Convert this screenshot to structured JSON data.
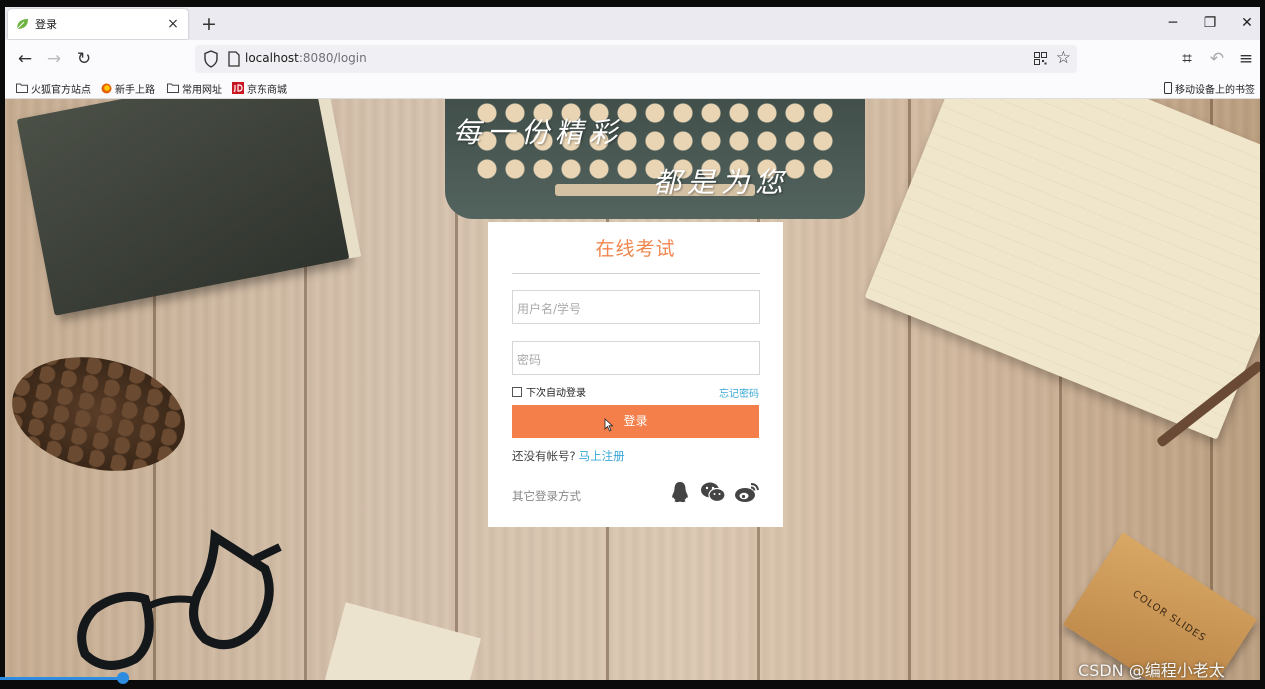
{
  "tab": {
    "title": "登录",
    "close": "×",
    "new_tab": "+"
  },
  "window": {
    "minimize": "─",
    "restore": "❐",
    "close": "✕"
  },
  "nav": {
    "back": "←",
    "forward": "→",
    "reload": "↻"
  },
  "address": {
    "host": "localhost",
    "path": ":8080/login",
    "star": "☆"
  },
  "toolbar": {
    "crop": "⌗",
    "undo": "↶",
    "menu": "≡"
  },
  "bookmarks": [
    {
      "label": "火狐官方站点"
    },
    {
      "label": "新手上路"
    },
    {
      "label": "常用网址"
    },
    {
      "label": "京东商城"
    }
  ],
  "mobile_bookmarks": "移动设备上的书签",
  "banner": {
    "line1": "每一份精彩",
    "line2": "都是为您"
  },
  "box_label": "COLOR SLIDES",
  "login": {
    "title": "在线考试",
    "username_placeholder": "用户名/学号",
    "password_placeholder": "密码",
    "remember": "下次自动登录",
    "forgot": "忘记密码",
    "submit": "登录",
    "no_account": "还没有帐号?",
    "register": "马上注册",
    "other_methods": "其它登录方式"
  },
  "watermark": "CSDN @编程小老太",
  "colors": {
    "accent": "#f47f4a",
    "link": "#3aa7d6",
    "title": "#f0874e"
  }
}
